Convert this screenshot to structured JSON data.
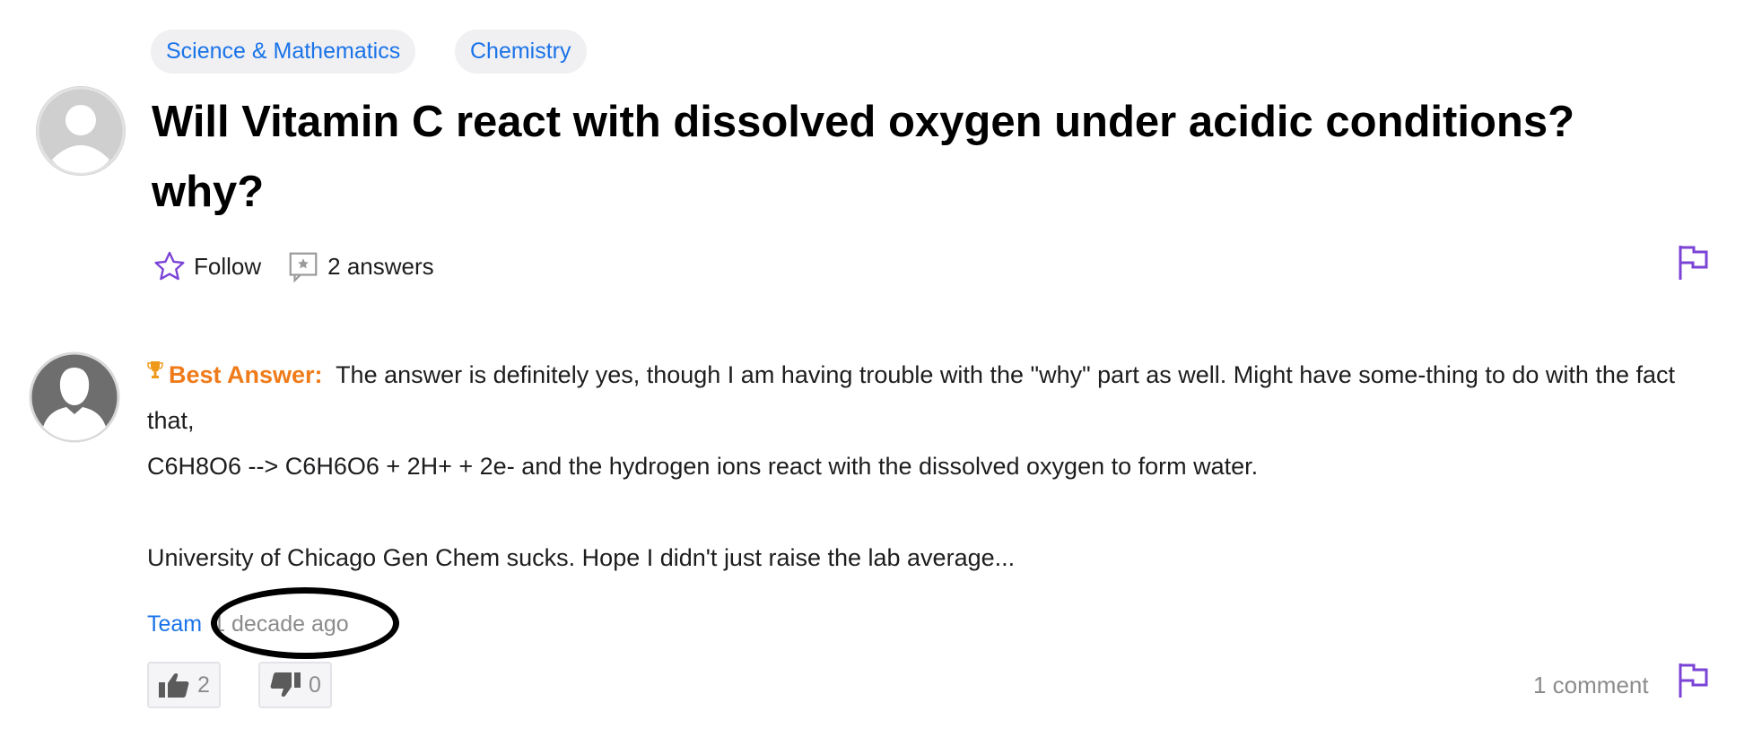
{
  "categories": [
    "Science & Mathematics",
    "Chemistry"
  ],
  "question": {
    "title": "Will Vitamin C react with dissolved oxygen under acidic conditions? why?",
    "follow_label": "Follow",
    "answers_count": "2 answers"
  },
  "best_answer": {
    "label": "Best Answer:",
    "line1": "The answer is definitely yes, though I am having trouble with the \"why\" part as well. Might have some-thing to do with the fact that,",
    "line2": "C6H8O6 --> C6H6O6 + 2H+ + 2e- and the hydrogen ions react with the dissolved oxygen to form water.",
    "line3": "University of Chicago Gen Chem sucks. Hope I didn't just raise the lab average...",
    "author": "Team",
    "time": "1 decade ago",
    "upvotes": "2",
    "downvotes": "0",
    "comments": "1 comment"
  },
  "colors": {
    "link": "#1a73e8",
    "best_answer": "#ef7b1a",
    "purple_icon": "#7b43d6",
    "muted": "#8b8b8b"
  },
  "icons": [
    "user-avatar-icon",
    "star-icon",
    "answers-icon",
    "flag-icon",
    "trophy-icon",
    "thumbs-up-icon",
    "thumbs-down-icon"
  ]
}
